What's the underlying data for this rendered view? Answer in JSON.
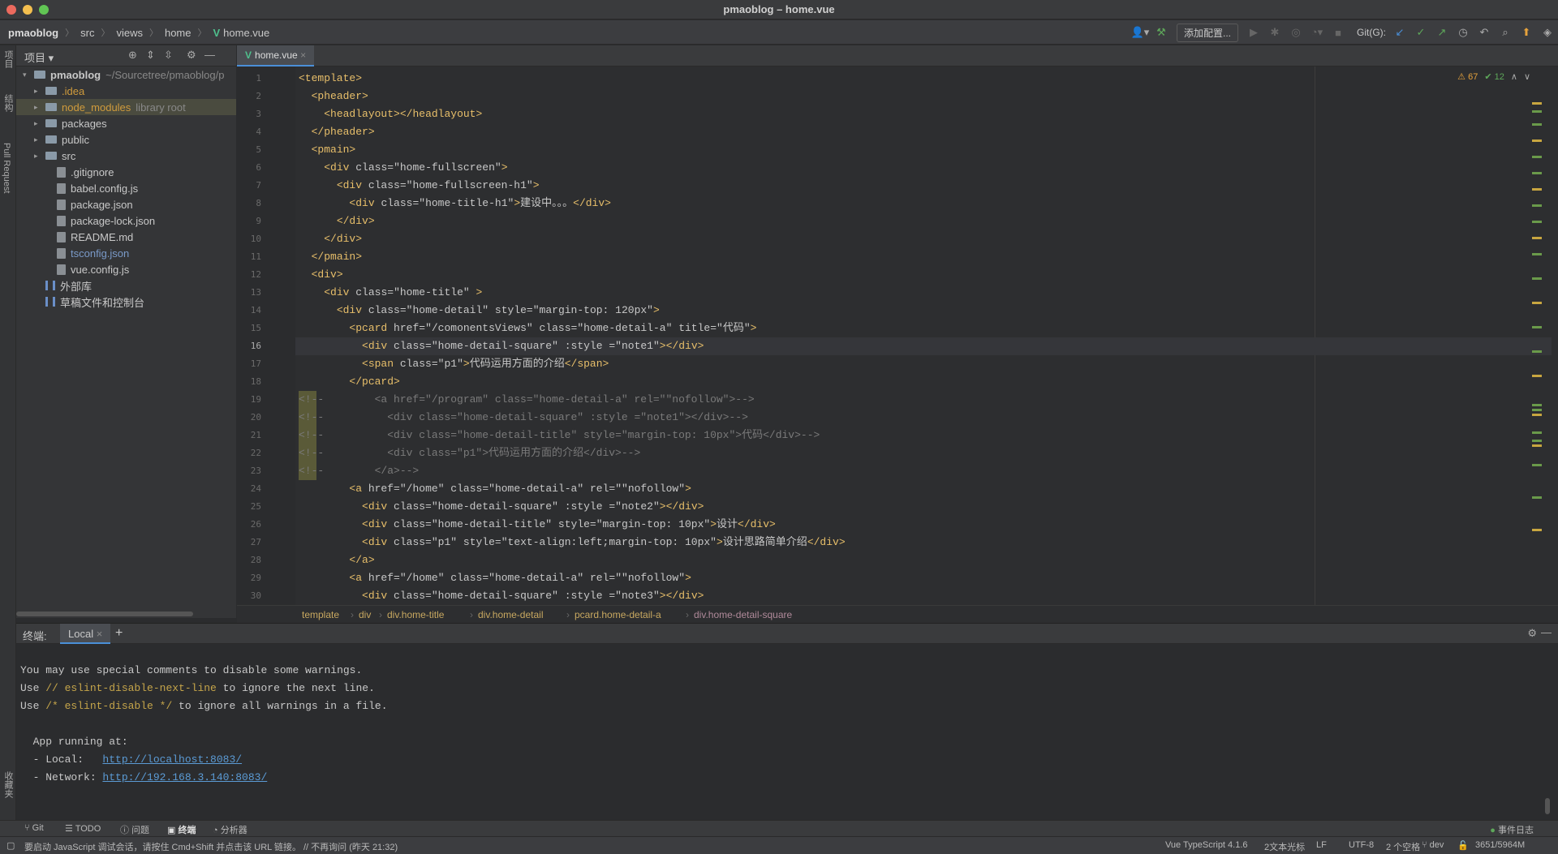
{
  "window": {
    "title": "pmaoblog – home.vue"
  },
  "breadcrumb": [
    "pmaoblog",
    "src",
    "views",
    "home",
    "home.vue"
  ],
  "toolbar": {
    "add_config": "添加配置...",
    "git_label": "Git(G):"
  },
  "left_strip": {
    "top": "项目",
    "mid": "结构",
    "pr": "Pull Request",
    "bottom": "收藏夹"
  },
  "project_panel": {
    "label": "项目"
  },
  "tree": [
    {
      "label": "pmaoblog",
      "suffix": "~/Sourcetree/pmaoblog/p",
      "kind": "folder",
      "depth": 0,
      "open": true
    },
    {
      "label": ".idea",
      "suffix": "",
      "kind": "folder",
      "depth": 1,
      "style": "orange"
    },
    {
      "label": "node_modules",
      "suffix": "library root",
      "kind": "folder",
      "depth": 1,
      "style": "orange",
      "highlight": true
    },
    {
      "label": "packages",
      "suffix": "",
      "kind": "folder",
      "depth": 1
    },
    {
      "label": "public",
      "suffix": "",
      "kind": "folder",
      "depth": 1
    },
    {
      "label": "src",
      "suffix": "",
      "kind": "folder",
      "depth": 1
    },
    {
      "label": ".gitignore",
      "suffix": "",
      "kind": "file",
      "depth": 2
    },
    {
      "label": "babel.config.js",
      "suffix": "",
      "kind": "file",
      "depth": 2
    },
    {
      "label": "package.json",
      "suffix": "",
      "kind": "file",
      "depth": 2
    },
    {
      "label": "package-lock.json",
      "suffix": "",
      "kind": "file",
      "depth": 2
    },
    {
      "label": "README.md",
      "suffix": "",
      "kind": "file",
      "depth": 2
    },
    {
      "label": "tsconfig.json",
      "suffix": "",
      "kind": "file",
      "depth": 2,
      "style": "dimblue"
    },
    {
      "label": "vue.config.js",
      "suffix": "",
      "kind": "file",
      "depth": 2
    },
    {
      "label": "外部库",
      "suffix": "",
      "kind": "lib",
      "depth": 1
    },
    {
      "label": "草稿文件和控制台",
      "suffix": "",
      "kind": "lib",
      "depth": 1
    }
  ],
  "editor": {
    "tab": "home.vue",
    "warnings": "67",
    "checks": "12",
    "current_line": 16,
    "lines": [
      "<template>",
      "  <pheader>",
      "    <headlayout></headlayout>",
      "  </pheader>",
      "  <pmain>",
      "    <div class=\"home-fullscreen\">",
      "      <div class=\"home-fullscreen-h1\">",
      "        <div class=\"home-title-h1\">建设中。。。</div>",
      "      </div>",
      "    </div>",
      "  </pmain>",
      "  <div>",
      "    <div class=\"home-title\" >",
      "      <div class=\"home-detail\" style=\"margin-top: 120px\">",
      "        <pcard href=\"/comonentsViews\" class=\"home-detail-a\" title=\"代码\">",
      "          <div class=\"home-detail-square\" :style =\"note1\"></div>",
      "          <span class=\"p1\">代码运用方面的介绍</span>",
      "        </pcard>",
      "<!--        <a href=\"/program\" class=\"home-detail-a\" rel=\"\"nofollow\">-->",
      "<!--          <div class=\"home-detail-square\" :style =\"note1\"></div>-->",
      "<!--          <div class=\"home-detail-title\" style=\"margin-top: 10px\">代码</div>-->",
      "<!--          <div class=\"p1\">代码运用方面的介绍</div>-->",
      "<!--        </a>-->",
      "        <a href=\"/home\" class=\"home-detail-a\" rel=\"\"nofollow\">",
      "          <div class=\"home-detail-square\" :style =\"note2\"></div>",
      "          <div class=\"home-detail-title\" style=\"margin-top: 10px\">设计</div>",
      "          <div class=\"p1\" style=\"text-align:left;margin-top: 10px\">设计思路简单介绍</div>",
      "        </a>",
      "        <a href=\"/home\" class=\"home-detail-a\" rel=\"\"nofollow\">",
      "          <div class=\"home-detail-square\" :style =\"note3\"></div>"
    ]
  },
  "code_breadcrumb": [
    "template",
    "div",
    "div.home-title",
    "div.home-detail",
    "pcard.home-detail-a",
    "div.home-detail-square"
  ],
  "terminal": {
    "label": "终端:",
    "tab": "Local",
    "lines": [
      "You may use special comments to disable some warnings.",
      "Use // eslint-disable-next-line to ignore the next line.",
      "Use /* eslint-disable */ to ignore all warnings in a file.",
      "",
      "  App running at:",
      "  - Local:   http://localhost:8083/",
      "  - Network: http://192.168.3.140:8083/"
    ]
  },
  "bottom_tabs": [
    "Git",
    "TODO",
    "问题",
    "终端",
    "分析器"
  ],
  "event_log": "事件日志",
  "status": {
    "message": "要启动 JavaScript 调试会话，请按住 Cmd+Shift 并点击该 URL 链接。 // 不再询问 (昨天 21:32)",
    "lang": "Vue TypeScript 4.1.6",
    "carets": "2文本光标",
    "eol": "LF",
    "encoding": "UTF-8",
    "indent": "2 个空格",
    "branch": "dev",
    "memory": "3651/5964M"
  }
}
